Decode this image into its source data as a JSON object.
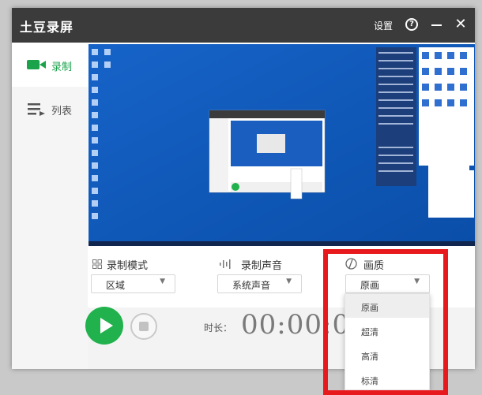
{
  "window": {
    "title": "土豆录屏"
  },
  "titlebar": {
    "settings_label": "设置",
    "help_glyph": "?",
    "close_glyph": "✕"
  },
  "sidebar": {
    "items": [
      {
        "label": "录制"
      },
      {
        "label": "列表"
      }
    ]
  },
  "controls": {
    "mode": {
      "label": "录制模式",
      "value": "区域"
    },
    "audio": {
      "label": "录制声音",
      "value": "系统声音"
    },
    "quality": {
      "label": "画质",
      "value": "原画"
    }
  },
  "recording": {
    "duration_label": "时长：",
    "timer": "00:00:00"
  },
  "quality_menu": {
    "options": [
      "原画",
      "超清",
      "高清",
      "标清"
    ],
    "selected": "原画"
  },
  "colors": {
    "accent": "#21b24e",
    "titlebar": "#3b3b3b",
    "desktop": "#0d57b8",
    "highlight": "#e8191c"
  }
}
